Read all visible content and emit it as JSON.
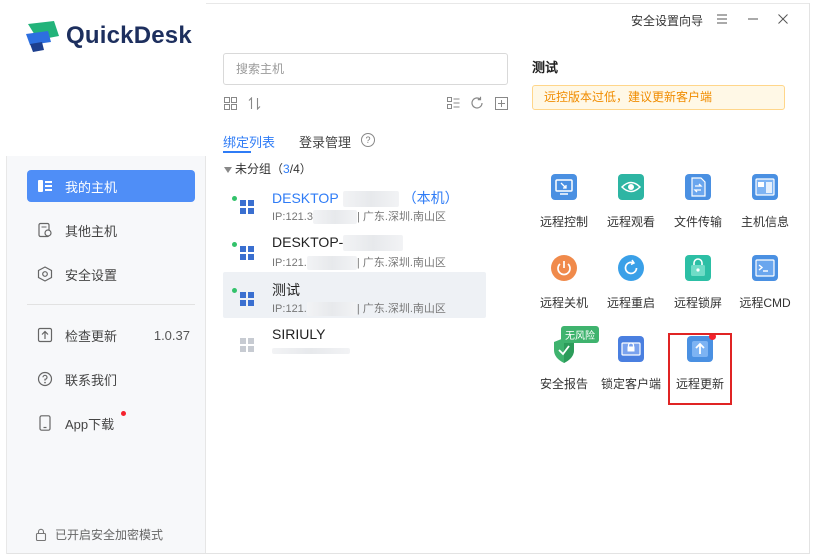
{
  "app": {
    "name": "QuickDesk"
  },
  "titlebar": {
    "security_guide": "安全设置向导",
    "menu_icon": "menu-icon",
    "minimize_icon": "minimize-icon",
    "close_icon": "close-icon"
  },
  "sidebar": {
    "items": [
      {
        "label": "我的主机",
        "icon": "hosts-icon",
        "active": true
      },
      {
        "label": "其他主机",
        "icon": "other-hosts-icon"
      },
      {
        "label": "安全设置",
        "icon": "security-icon"
      },
      {
        "label": "检查更新",
        "icon": "update-icon",
        "version": "1.0.37"
      },
      {
        "label": "联系我们",
        "icon": "help-icon"
      },
      {
        "label": "App下载",
        "icon": "phone-icon",
        "has_dot": true
      }
    ],
    "footer": "已开启安全加密模式"
  },
  "search": {
    "placeholder": "搜索主机"
  },
  "tabs": [
    {
      "label": "绑定列表",
      "active": true
    },
    {
      "label": "登录管理"
    }
  ],
  "group": {
    "name": "未分组",
    "open": "（",
    "online": "3",
    "slash": "/",
    "total": "4",
    "close": "）"
  },
  "hosts": [
    {
      "name": "DESKTOP",
      "suffix": "（本机）",
      "ip_prefix": "IP:121.3",
      "location": "| 广东.深圳.南山区",
      "online": true,
      "local": true
    },
    {
      "name": "DESKTOP-",
      "suffix": "",
      "ip_prefix": "IP:121.",
      "location": "| 广东.深圳.南山区",
      "online": true
    },
    {
      "name": "测试",
      "suffix": "",
      "ip_prefix": "IP:121.",
      "location": "| 广东.深圳.南山区",
      "online": true,
      "selected": true
    },
    {
      "name": "SIRIULY",
      "suffix": "",
      "ip_prefix": "",
      "location": "",
      "online": false
    }
  ],
  "detail": {
    "title": "测试",
    "warning": "远控版本过低，建议更新客户端",
    "actions": [
      {
        "label": "远程控制",
        "icon": "remote-control-icon",
        "color": "#4a90e2"
      },
      {
        "label": "远程观看",
        "icon": "remote-view-icon",
        "color": "#2db5a3"
      },
      {
        "label": "文件传输",
        "icon": "file-transfer-icon",
        "color": "#4a90e2"
      },
      {
        "label": "主机信息",
        "icon": "host-info-icon",
        "color": "#4a90e2"
      },
      {
        "label": "远程关机",
        "icon": "remote-shutdown-icon",
        "color": "#f08a4b"
      },
      {
        "label": "远程重启",
        "icon": "remote-restart-icon",
        "color": "#3aa0e8"
      },
      {
        "label": "远程锁屏",
        "icon": "remote-lock-icon",
        "color": "#2cbfa5"
      },
      {
        "label": "远程CMD",
        "icon": "remote-cmd-icon",
        "color": "#4a90e2"
      },
      {
        "label": "安全报告",
        "icon": "security-report-icon",
        "color": "#3fb36e",
        "badge": "无风险"
      },
      {
        "label": "锁定客户端",
        "icon": "lock-client-icon",
        "color": "#4a7fe0"
      },
      {
        "label": "远程更新",
        "icon": "remote-update-icon",
        "color": "#4a90e2",
        "has_dot": true
      }
    ]
  }
}
